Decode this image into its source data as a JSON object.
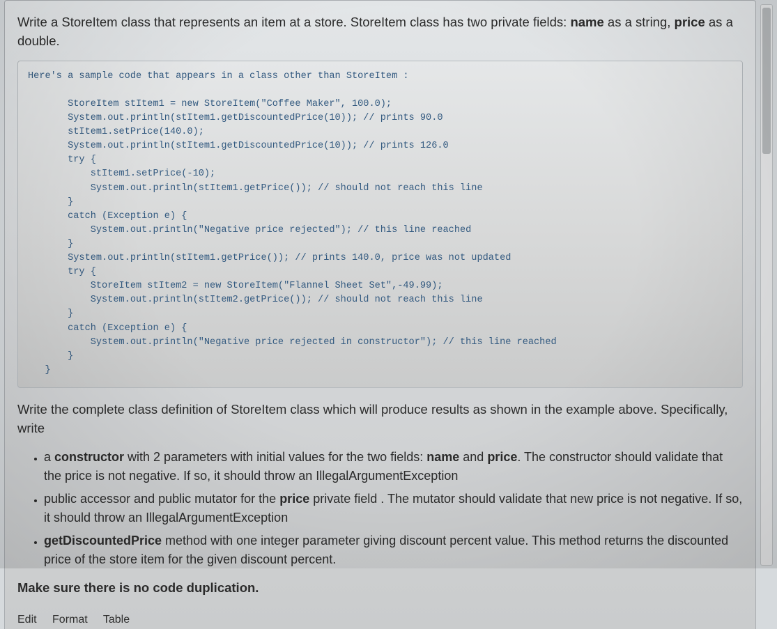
{
  "intro": {
    "p1a": "Write a StoreItem class that represents an item at a store. StoreItem class  has two private fields:  ",
    "p1b": "name",
    "p1c": " as a string, ",
    "p1d": "price",
    "p1e": " as a double."
  },
  "code_lead": "Here's a sample code that appears in a class other than StoreItem :",
  "code_body": "       StoreItem stItem1 = new StoreItem(\"Coffee Maker\", 100.0);\n       System.out.println(stItem1.getDiscountedPrice(10)); // prints 90.0\n       stItem1.setPrice(140.0);\n       System.out.println(stItem1.getDiscountedPrice(10)); // prints 126.0\n       try {\n           stItem1.setPrice(-10);\n           System.out.println(stItem1.getPrice()); // should not reach this line\n       }\n       catch (Exception e) {\n           System.out.println(\"Negative price rejected\"); // this line reached\n       }\n       System.out.println(stItem1.getPrice()); // prints 140.0, price was not updated\n       try {\n           StoreItem stItem2 = new StoreItem(\"Flannel Sheet Set\",-49.99);\n           System.out.println(stItem2.getPrice()); // should not reach this line\n       }\n       catch (Exception e) {\n           System.out.println(\"Negative price rejected in constructor\"); // this line reached\n       }\n   }",
  "post": "Write the complete class definition of StoreItem class which will produce results as shown in the example above. Specifically, write",
  "bullets": {
    "b1": {
      "a": "a ",
      "b": "constructor",
      "c": " with 2 parameters with initial values for the two fields: ",
      "d": "name",
      "e": " and ",
      "f": "price",
      "g": ". The constructor should validate that the price is not negative. If so, it should throw an IllegalArgumentException"
    },
    "b2": {
      "a": "public accessor and public mutator for the ",
      "b": "price",
      "c": " private field . The mutator should validate that new price is not negative. If so, it should throw an IllegalArgumentException"
    },
    "b3": {
      "a": "",
      "b": "getDiscountedPrice",
      "c": " method with one integer parameter giving discount percent value. This method returns the discounted price of the store item for the given discount percent."
    }
  },
  "note": "Make sure there is no code duplication.",
  "toolbar": {
    "edit": "Edit",
    "format": "Format",
    "table": "Table"
  }
}
